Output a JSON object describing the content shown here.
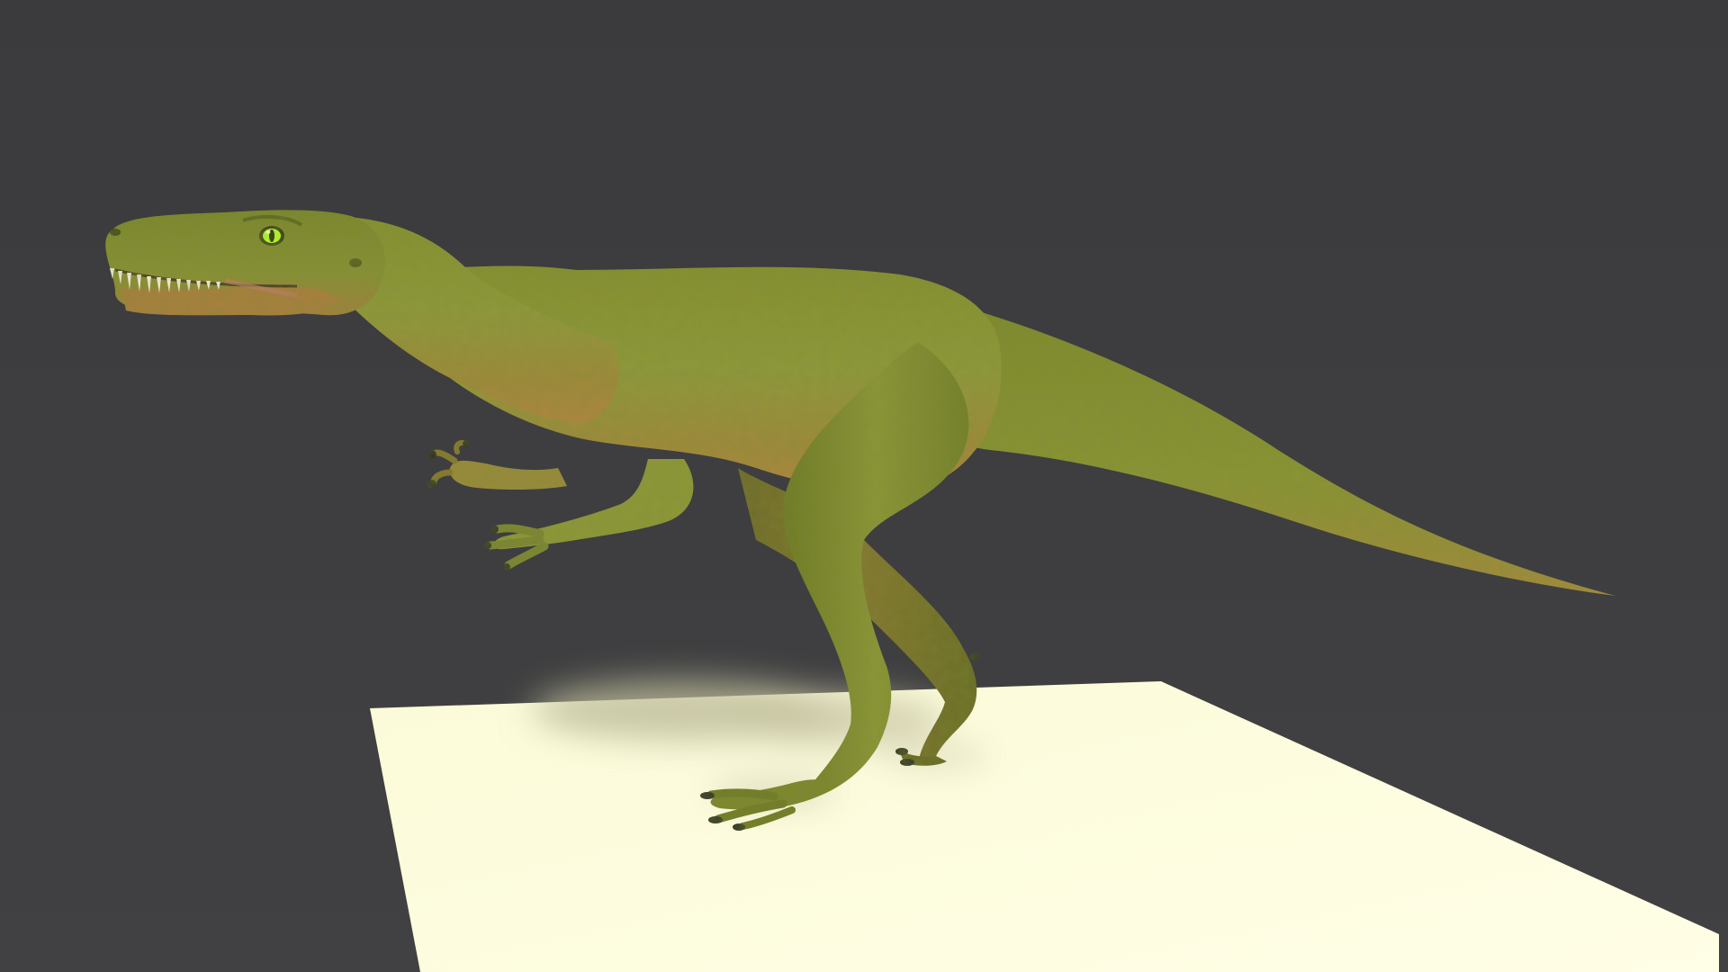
{
  "scene": {
    "subject": "theropod-dinosaur-render",
    "colors": {
      "background": "#3d3d3f",
      "ground_plane": "#fbfbd9",
      "skin_light": "#9aa23e",
      "skin_mid": "#7d862d",
      "skin_dark": "#5c6a1f",
      "belly": "#b3883a",
      "eye": "#b8ff2a",
      "teeth": "#f4efd6",
      "claws": "#2f3128",
      "shadow": "#c9c7a6"
    }
  }
}
